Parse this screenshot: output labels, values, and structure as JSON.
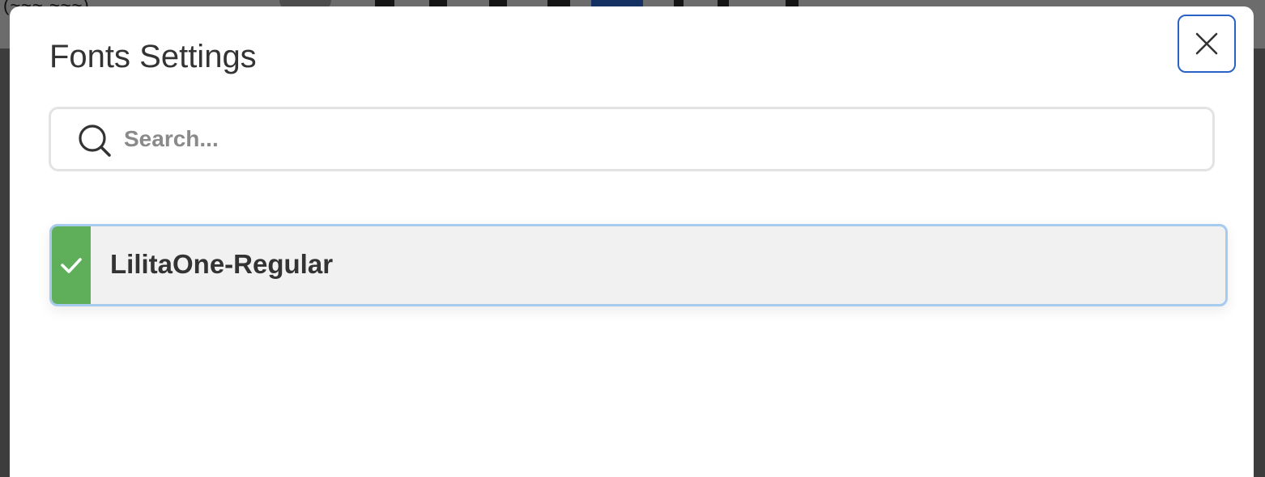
{
  "background": {
    "partial_text": "(~~~ ~~~)"
  },
  "dialog": {
    "title": "Fonts Settings",
    "close_icon": "close-icon",
    "search": {
      "placeholder": "Search...",
      "value": "",
      "icon": "search-icon"
    },
    "fonts": [
      {
        "name": "LilitaOne-Regular",
        "selected": true,
        "status_icon": "check-icon"
      }
    ]
  },
  "colors": {
    "accent_border": "#2a62c6",
    "selected_border": "#a6cbef",
    "check_green": "#5fae5a",
    "item_background": "#f1f1f1"
  }
}
